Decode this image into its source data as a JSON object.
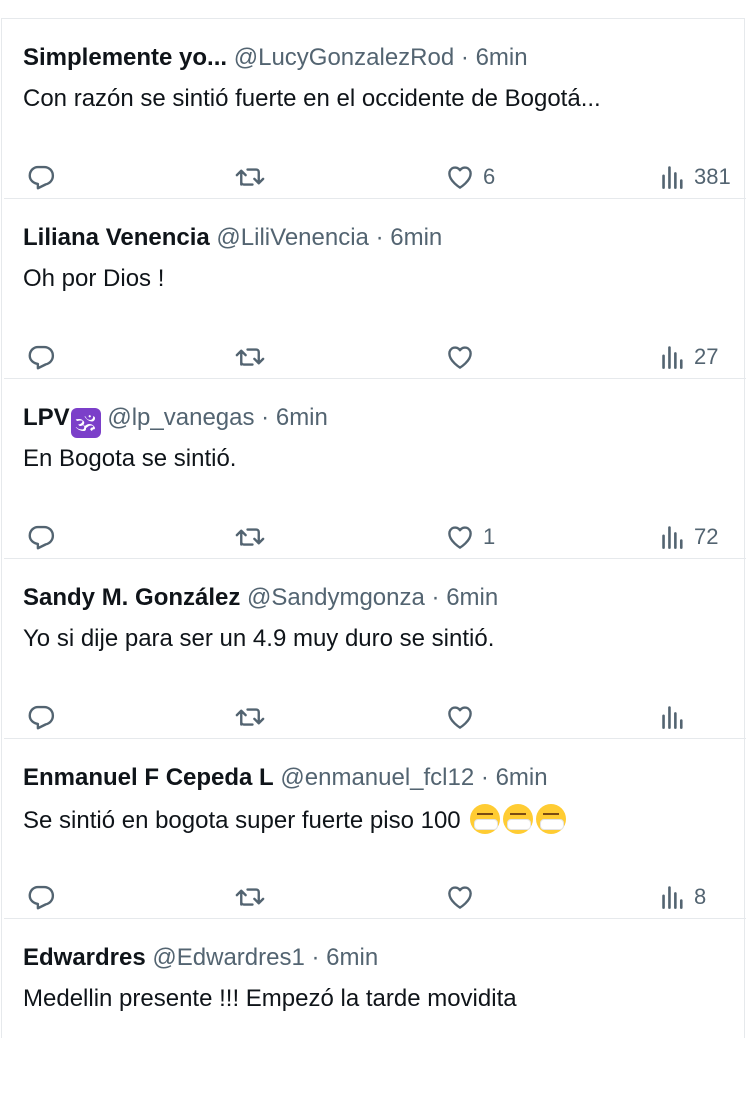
{
  "tweets": [
    {
      "name": "Simplemente yo...",
      "handle": "@LucyGonzalezRod",
      "dot": "·",
      "time": "6min",
      "text": "Con razón se sintió fuerte en el occidente de Bogotá...",
      "likes": "6",
      "views": "381"
    },
    {
      "name": "Liliana Venencia",
      "handle": "@LiliVenencia",
      "dot": "·",
      "time": "6min",
      "text": "Oh por Dios !",
      "likes": "",
      "views": "27"
    },
    {
      "name": "LPV",
      "name_emoji": "🕉",
      "handle": "@lp_vanegas",
      "dot": "·",
      "time": "6min",
      "text": "En Bogota se sintió.",
      "likes": "1",
      "views": "72"
    },
    {
      "name": "Sandy M. González",
      "handle": "@Sandymgonza",
      "dot": "·",
      "time": "6min",
      "text": "Yo si dije para ser un 4.9 muy duro se sintió.",
      "likes": "",
      "views": ""
    },
    {
      "name": "Enmanuel F Cepeda L",
      "handle": "@enmanuel_fcl12",
      "dot": "·",
      "time": "6min",
      "text": "Se sintió en bogota super fuerte piso 100",
      "emojis": [
        "sneezing-face",
        "sneezing-face",
        "sneezing-face"
      ],
      "likes": "",
      "views": "8"
    },
    {
      "name": "Edwardres",
      "handle": "@Edwardres1",
      "dot": "·",
      "time": "6min",
      "text": "Medellin presente !!! Empezó la tarde movidita"
    }
  ],
  "icons": {
    "reply": "reply-icon",
    "retweet": "retweet-icon",
    "like": "heart-icon",
    "views": "views-icon"
  },
  "colors": {
    "text": "#0f1419",
    "secondary": "#536471",
    "divider": "#e6e9ec"
  }
}
